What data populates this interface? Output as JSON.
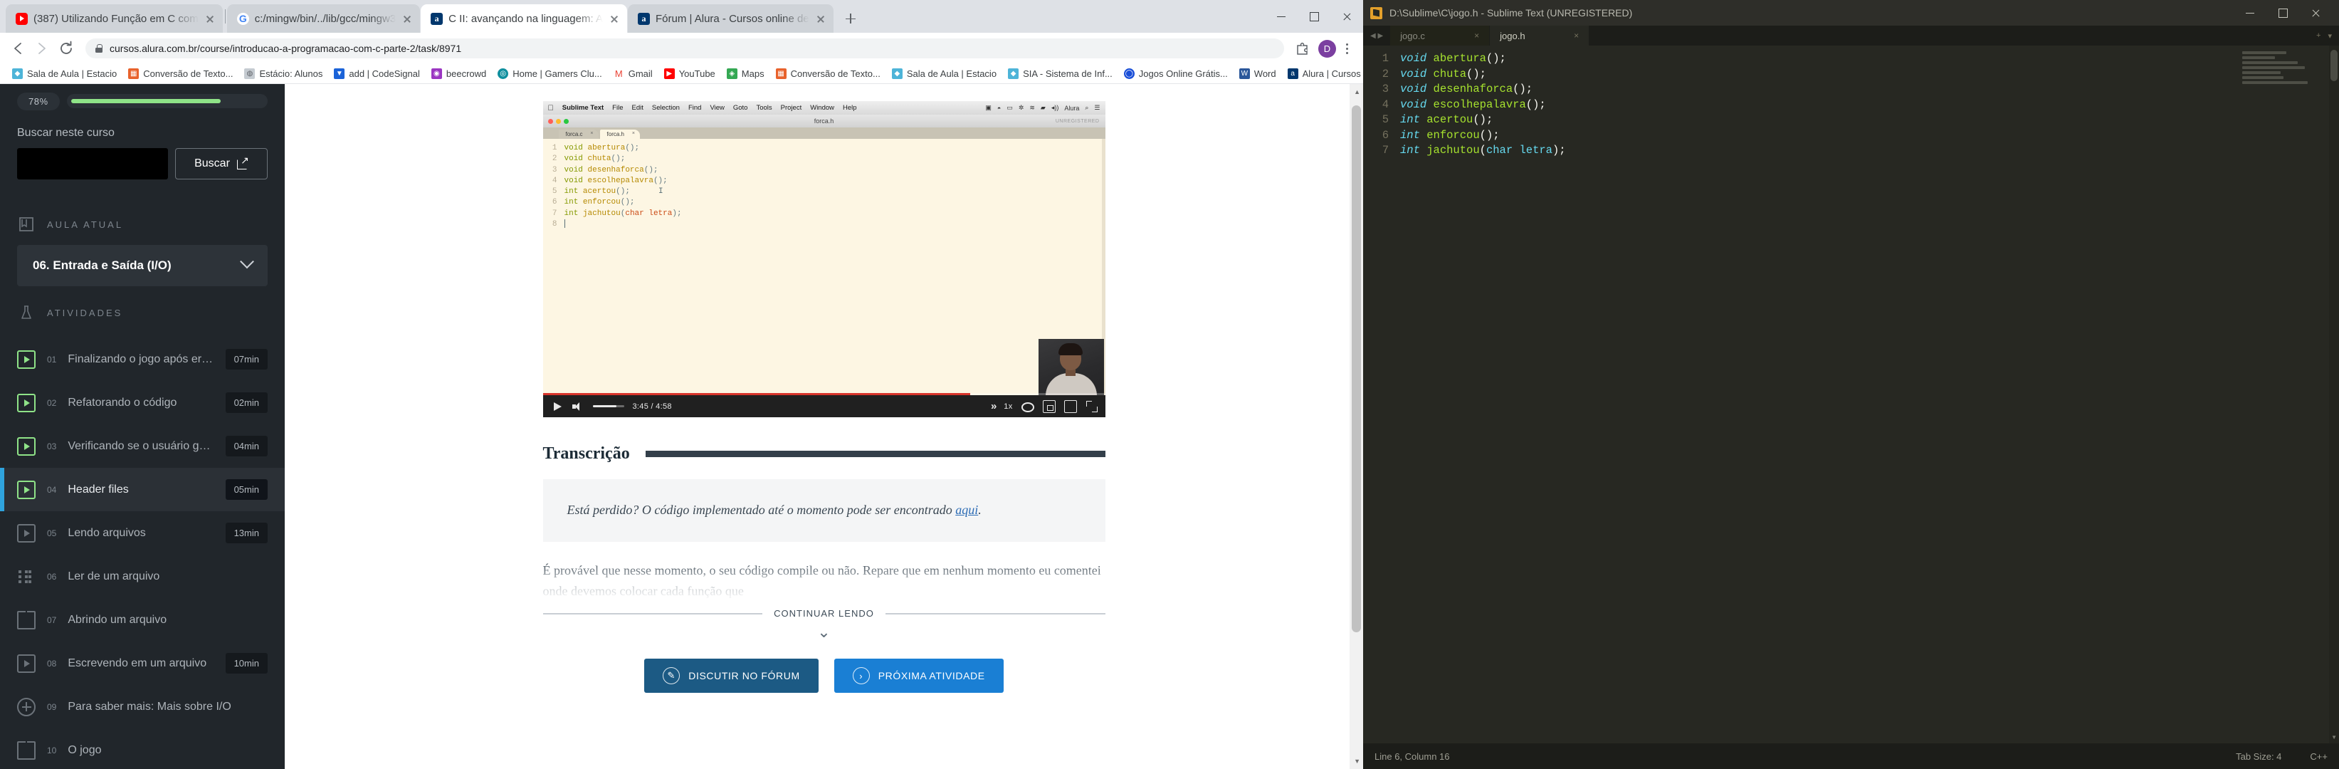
{
  "browser": {
    "tabs": [
      {
        "title": "(387) Utilizando Função em C com",
        "icon": "youtube-icon",
        "active": false
      },
      {
        "title": "c:/mingw/bin/../lib/gcc/mingw3",
        "icon": "google-icon",
        "active": false
      },
      {
        "title": "C II: avançando na linguagem: A",
        "icon": "alura-icon",
        "active": true
      },
      {
        "title": "Fórum | Alura - Cursos online de",
        "icon": "alura-icon",
        "active": false
      }
    ],
    "new_tab_label": "+",
    "url": "cursos.alura.com.br/course/introducao-a-programacao-com-c-parte-2/task/8971",
    "avatar_initial": "D",
    "bookmarks": [
      {
        "label": "Sala de Aula | Estacio",
        "color": "#4db4d8"
      },
      {
        "label": "Conversão de Texto...",
        "color": "#e8622c"
      },
      {
        "label": "Estácio: Alunos",
        "color": "#c5cbd1"
      },
      {
        "label": "add | CodeSignal",
        "color": "#1b63d8"
      },
      {
        "label": "beecrowd",
        "color": "#9b36c2"
      },
      {
        "label": "Home | Gamers Clu...",
        "color": "#0f8f9e"
      },
      {
        "label": "Gmail",
        "color": "#ea4335"
      },
      {
        "label": "YouTube",
        "color": "#ff0000"
      },
      {
        "label": "Maps",
        "color": "#34a853"
      },
      {
        "label": "Conversão de Texto...",
        "color": "#e8622c"
      },
      {
        "label": "Sala de Aula | Estacio",
        "color": "#4db4d8"
      },
      {
        "label": "SIA - Sistema de Inf...",
        "color": "#4db4d8"
      },
      {
        "label": "Jogos Online Grátis...",
        "color": "#1a4fd8"
      },
      {
        "label": "Word",
        "color": "#2b579a"
      },
      {
        "label": "Alura | Cursos onlin...",
        "color": "#00376d"
      }
    ],
    "bookmarks_overflow": "»"
  },
  "sidebar": {
    "progress_percent": "78%",
    "progress_value": 78,
    "search_label": "Buscar neste curso",
    "search_value": "",
    "search_placeholder": "",
    "search_button": "Buscar",
    "current_lesson_header": "AULA ATUAL",
    "current_lesson": "06. Entrada e Saída (I/O)",
    "activities_header": "ATIVIDADES",
    "activities": [
      {
        "num": "01",
        "title": "Finalizando o jogo após erros se...",
        "time": "07min",
        "icon": "video-icon",
        "state": "done"
      },
      {
        "num": "02",
        "title": "Refatorando o código",
        "time": "02min",
        "icon": "video-icon",
        "state": "done"
      },
      {
        "num": "03",
        "title": "Verificando se o usuário ganhou ...",
        "time": "04min",
        "icon": "video-icon",
        "state": "done"
      },
      {
        "num": "04",
        "title": "Header files",
        "time": "05min",
        "icon": "video-icon",
        "state": "active"
      },
      {
        "num": "05",
        "title": "Lendo arquivos",
        "time": "13min",
        "icon": "video-icon",
        "state": "normal"
      },
      {
        "num": "06",
        "title": "Ler de um arquivo",
        "time": "",
        "icon": "list-icon",
        "state": "normal"
      },
      {
        "num": "07",
        "title": "Abrindo um arquivo",
        "time": "",
        "icon": "book-icon",
        "state": "normal"
      },
      {
        "num": "08",
        "title": "Escrevendo em um arquivo",
        "time": "10min",
        "icon": "video-icon",
        "state": "normal"
      },
      {
        "num": "09",
        "title": "Para saber mais: Mais sobre I/O",
        "time": "",
        "icon": "plus-circle-icon",
        "state": "normal"
      },
      {
        "num": "10",
        "title": "O jogo",
        "time": "",
        "icon": "book-icon",
        "state": "normal"
      }
    ]
  },
  "video": {
    "current_time": "3:45",
    "duration": "4:58",
    "time_display": "3:45 / 4:58",
    "speed": "1x",
    "progress_percent": 76,
    "editor": {
      "app_name": "Sublime Text",
      "menus": [
        "File",
        "Edit",
        "Selection",
        "Find",
        "View",
        "Goto",
        "Tools",
        "Project",
        "Window",
        "Help"
      ],
      "menu_right": [
        "Alura"
      ],
      "window_title": "forca.h",
      "unregistered": "UNREGISTERED",
      "tabs": [
        {
          "name": "forca.c",
          "selected": false
        },
        {
          "name": "forca.h",
          "selected": true
        }
      ],
      "lines": [
        {
          "n": "1",
          "kw": "void",
          "fn": "abertura",
          "args": "",
          "tail": "();"
        },
        {
          "n": "2",
          "kw": "void",
          "fn": "chuta",
          "args": "",
          "tail": "();"
        },
        {
          "n": "3",
          "kw": "void",
          "fn": "desenhaforca",
          "args": "",
          "tail": "();"
        },
        {
          "n": "4",
          "kw": "void",
          "fn": "escolhepalavra",
          "args": "",
          "tail": "();"
        },
        {
          "n": "5",
          "kw": "int",
          "fn": "acertou",
          "args": "",
          "tail": "();"
        },
        {
          "n": "6",
          "kw": "int",
          "fn": "enforcou",
          "args": "",
          "tail": "();"
        },
        {
          "n": "7",
          "kw": "int",
          "fn": "jachutou",
          "args": "char letra",
          "tail": "();"
        },
        {
          "n": "8",
          "kw": "",
          "fn": "",
          "args": "",
          "tail": ""
        }
      ]
    }
  },
  "content": {
    "transcription_title": "Transcrição",
    "quote_text": "Está perdido? O código implementado até o momento pode ser encontrado ",
    "quote_link": "aqui",
    "quote_end": ".",
    "body_text": "É provável que nesse momento, o seu código compile ou não. Repare que em nenhum momento eu comentei onde devemos colocar cada função que",
    "continue_label": "CONTINUAR LENDO",
    "chevron": "⌄",
    "buttons": [
      {
        "label": "DISCUTIR NO FÓRUM",
        "icon": "chat-icon",
        "style": "forum"
      },
      {
        "label": "PRÓXIMA ATIVIDADE",
        "icon": "arrow-right-icon",
        "style": "next"
      }
    ]
  },
  "sublime": {
    "title": "D:\\Sublime\\C\\jogo.h - Sublime Text (UNREGISTERED)",
    "tabs": [
      {
        "name": "jogo.c",
        "selected": false
      },
      {
        "name": "jogo.h",
        "selected": true
      }
    ],
    "code_lines": [
      {
        "n": "1",
        "kw": "void",
        "fn": "abertura",
        "args": "",
        "tail": "();"
      },
      {
        "n": "2",
        "kw": "void",
        "fn": "chuta",
        "args": "",
        "tail": "();"
      },
      {
        "n": "3",
        "kw": "void",
        "fn": "desenhaforca",
        "args": "",
        "tail": "();"
      },
      {
        "n": "4",
        "kw": "void",
        "fn": "escolhepalavra",
        "args": "",
        "tail": "();"
      },
      {
        "n": "5",
        "kw": "int",
        "fn": "acertou",
        "args": "",
        "tail": "();"
      },
      {
        "n": "6",
        "kw": "int",
        "fn": "enforcou",
        "args": "",
        "tail": "();"
      },
      {
        "n": "7",
        "kw": "int",
        "fn": "jachutou",
        "args": "char letra",
        "tail": "();"
      }
    ],
    "status_left": "Line 6, Column 16",
    "status_tab_size": "Tab Size: 4",
    "status_syntax": "C++"
  },
  "colors": {
    "accent_blue": "#1a7fd4",
    "active_marker": "#2fa3dd",
    "progress_green": "#8fe388",
    "sidebar_bg": "#21262b",
    "editor_bg": "#272822",
    "youtube_red": "#d8342b"
  }
}
